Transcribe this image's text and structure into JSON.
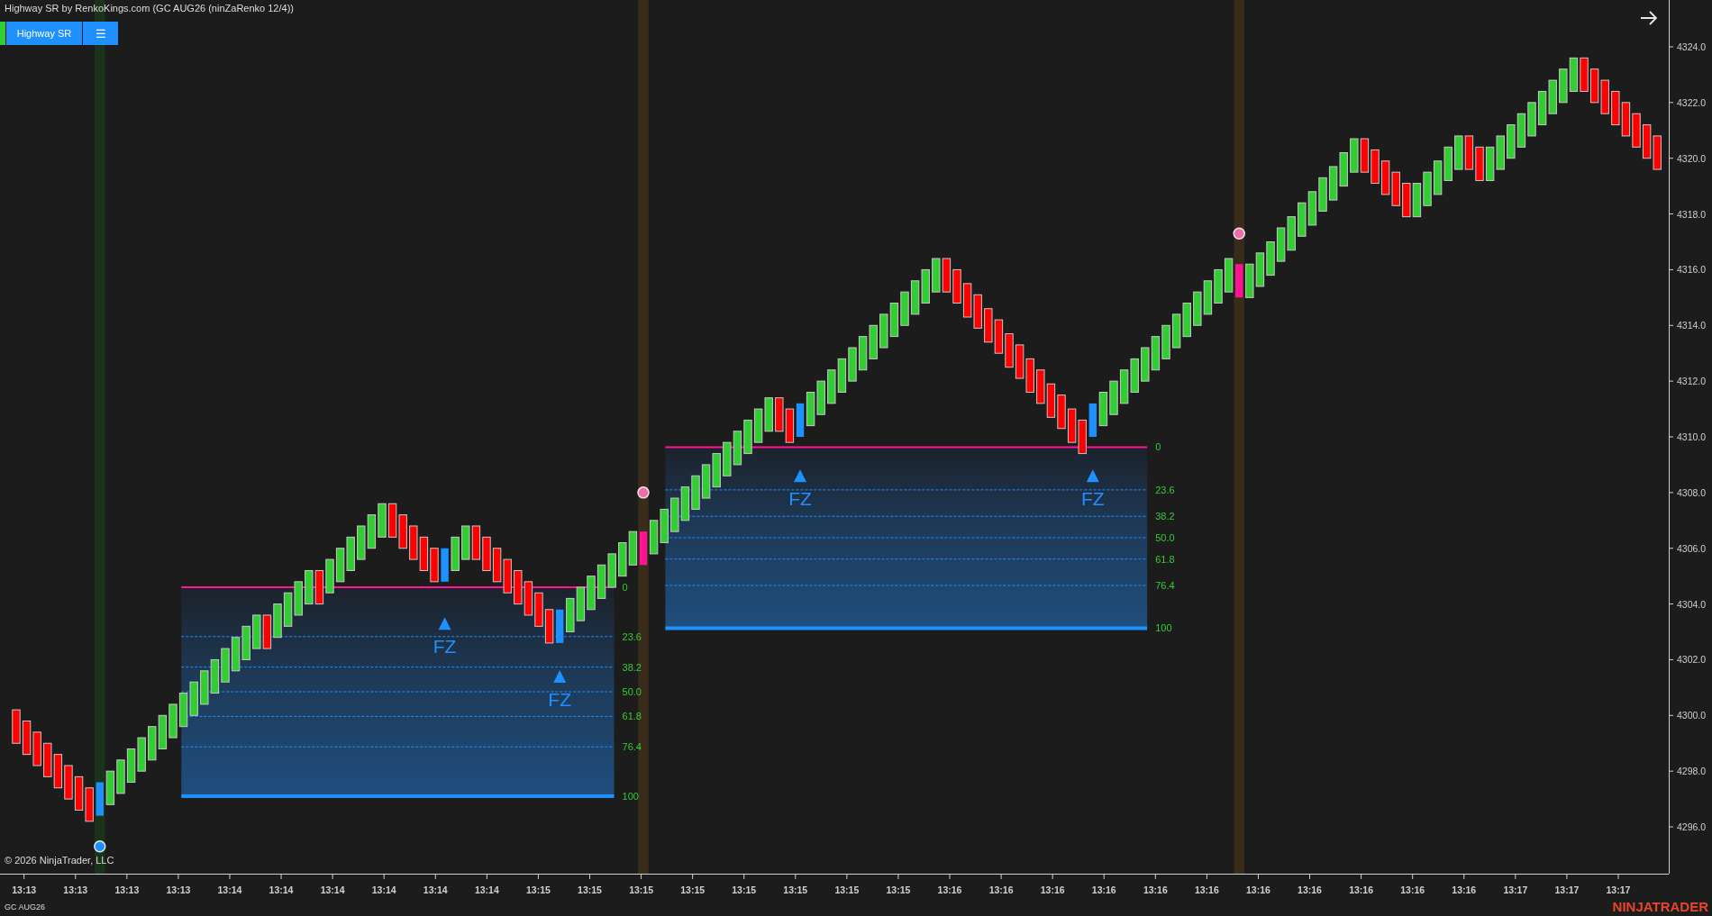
{
  "window": {
    "title": "Highway SR by RenkoKings.com (GC AUG26 (ninZaRenko 12/4))"
  },
  "toolbar": {
    "buttons": [
      {
        "label": "Highway SR"
      },
      {
        "label": "☰"
      }
    ]
  },
  "fib_zones": [
    {
      "levels": [
        "0",
        "23.6",
        "38.2",
        "50.0",
        "61.8",
        "76.4",
        "100"
      ]
    },
    {
      "levels": [
        "0",
        "23.6",
        "38.2",
        "50.0",
        "61.8",
        "76.4",
        "100"
      ]
    }
  ],
  "signals": [
    {
      "label": "FZ"
    },
    {
      "label": "FZ"
    },
    {
      "label": "FZ"
    },
    {
      "label": "FZ"
    }
  ],
  "price_axis": {
    "labels": [
      "4324.0",
      "4322.0",
      "4320.0",
      "4318.0",
      "4316.0",
      "4314.0",
      "4312.0",
      "4310.0",
      "4308.0",
      "4306.0",
      "4304.0",
      "4302.0",
      "4300.0",
      "4298.0",
      "4296.0"
    ]
  },
  "time_axis": {
    "labels": [
      "13:13",
      "13:13",
      "13:13",
      "13:13",
      "13:14",
      "13:14",
      "13:14",
      "13:14",
      "13:14",
      "13:14",
      "13:15",
      "13:15",
      "13:15",
      "13:15",
      "13:15",
      "13:15",
      "13:15",
      "13:15",
      "13:16",
      "13:16",
      "13:16",
      "13:16",
      "13:16",
      "13:16",
      "13:16",
      "13:16",
      "13:16",
      "13:16",
      "13:16",
      "13:17",
      "13:17",
      "13:17"
    ]
  },
  "copyright": "© 2026 NinjaTrader, LLC",
  "instrument": "GC AUG26",
  "logo": "NINJATRADER"
}
